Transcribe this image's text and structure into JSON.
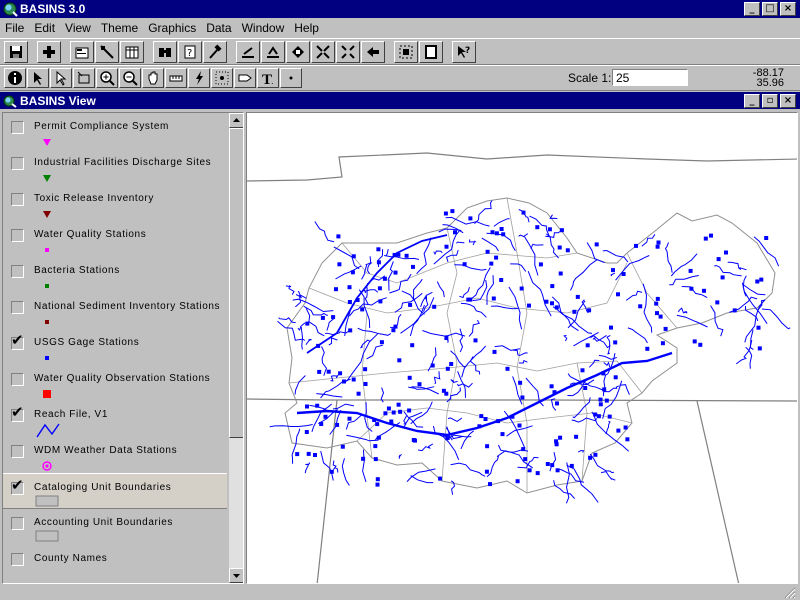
{
  "app": {
    "title": "BASINS 3.0",
    "title_buttons": [
      "_",
      "□",
      "×"
    ]
  },
  "menu": [
    "File",
    "Edit",
    "View",
    "Theme",
    "Graphics",
    "Data",
    "Window",
    "Help"
  ],
  "toolbar2": {
    "scale_label": "Scale 1:",
    "scale_value": "25",
    "coord_x": "-88.17",
    "coord_y": "35.96"
  },
  "view": {
    "title": "BASINS View",
    "buttons": [
      "_",
      "▫",
      "×"
    ]
  },
  "toc": [
    {
      "label": "Permit Compliance System",
      "checked": false,
      "symbol": "triangle",
      "color": "#ff00ff"
    },
    {
      "label": "Industrial Facilities Discharge Sites",
      "checked": false,
      "symbol": "triangle",
      "color": "#008000"
    },
    {
      "label": "Toxic Release Inventory",
      "checked": false,
      "symbol": "triangle",
      "color": "#800000"
    },
    {
      "label": "Water Quality Stations",
      "checked": false,
      "symbol": "square",
      "color": "#ff00ff"
    },
    {
      "label": "Bacteria Stations",
      "checked": false,
      "symbol": "square",
      "color": "#008000"
    },
    {
      "label": "National Sediment Inventory Stations",
      "checked": false,
      "symbol": "square",
      "color": "#800000"
    },
    {
      "label": "USGS Gage Stations",
      "checked": true,
      "symbol": "square",
      "color": "#0000ff"
    },
    {
      "label": "Water Quality Observation Stations",
      "checked": false,
      "symbol": "bigsquare",
      "color": "#ff0000"
    },
    {
      "label": "Reach File, V1",
      "checked": true,
      "symbol": "line",
      "color": "#0000ff"
    },
    {
      "label": "WDM Weather Data Stations",
      "checked": false,
      "symbol": "circle",
      "color": "#ff00ff"
    },
    {
      "label": "Cataloging Unit Boundaries",
      "checked": true,
      "symbol": "rect",
      "color": "#c0c0c0",
      "selected": true
    },
    {
      "label": "Accounting Unit Boundaries",
      "checked": false,
      "symbol": "rect",
      "color": "#c0c0c0"
    },
    {
      "label": "County Names",
      "checked": false,
      "symbol": "none",
      "color": "#000000"
    }
  ],
  "colors": {
    "titlebar": "#000080",
    "stream": "#0000ff",
    "boundary": "#808080"
  }
}
